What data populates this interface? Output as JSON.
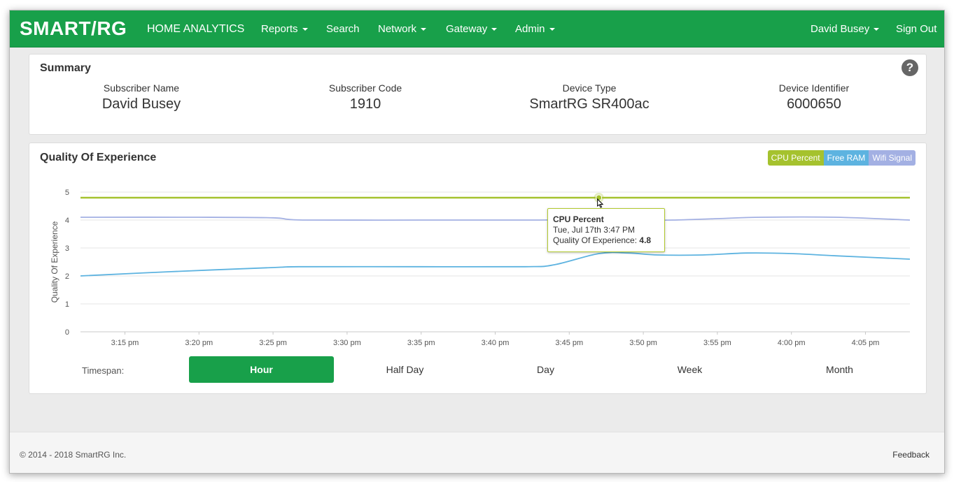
{
  "navbar": {
    "brand": "SMART/RG",
    "title": "HOME ANALYTICS",
    "menu": [
      "Reports",
      "Search",
      "Network",
      "Gateway",
      "Admin"
    ],
    "user": "David Busey",
    "signout": "Sign Out"
  },
  "summary": {
    "title": "Summary",
    "help": "?",
    "fields": [
      {
        "label": "Subscriber Name",
        "value": "David Busey"
      },
      {
        "label": "Subscriber Code",
        "value": "1910"
      },
      {
        "label": "Device Type",
        "value": "SmartRG SR400ac"
      },
      {
        "label": "Device Identifier",
        "value": "6000650"
      }
    ]
  },
  "qoe": {
    "title": "Quality Of Experience",
    "legend": [
      {
        "label": "CPU Percent",
        "color": "#a5c22e"
      },
      {
        "label": "Free RAM",
        "color": "#5db3e0"
      },
      {
        "label": "Wifi Signal",
        "color": "#a3b0e3"
      }
    ],
    "tooltip": {
      "series": "CPU Percent",
      "time": "Tue, Jul 17th 3:47 PM",
      "label": "Quality Of Experience:",
      "value": "4.8"
    },
    "timespan_label": "Timespan:",
    "timespans": [
      "Hour",
      "Half Day",
      "Day",
      "Week",
      "Month"
    ],
    "active_timespan": "Hour"
  },
  "chart_data": {
    "type": "line",
    "ylabel": "Quality Of Experience",
    "ylim": [
      0,
      5
    ],
    "yticks": [
      0,
      1,
      2,
      3,
      4,
      5
    ],
    "xlim_minutes": [
      12,
      68
    ],
    "xticks": [
      "3:15 pm",
      "3:20 pm",
      "3:25 pm",
      "3:30 pm",
      "3:35 pm",
      "3:40 pm",
      "3:45 pm",
      "3:50 pm",
      "3:55 pm",
      "4:00 pm",
      "4:05 pm"
    ],
    "grid": true,
    "legend_position": "top-right",
    "series": [
      {
        "name": "CPU Percent",
        "color": "#a5c22e",
        "x": [
          "3:12 pm",
          "4:08 pm"
        ],
        "values": [
          4.8,
          4.8
        ]
      },
      {
        "name": "Free RAM",
        "color": "#5db3e0",
        "x": [
          "3:12 pm",
          "3:18 pm",
          "3:25 pm",
          "3:27 pm",
          "3:35 pm",
          "3:42 pm",
          "3:44 pm",
          "3:47 pm",
          "3:49 pm",
          "3:51 pm",
          "3:54 pm",
          "3:57 pm",
          "4:00 pm",
          "4:03 pm",
          "4:08 pm"
        ],
        "values": [
          2.0,
          2.15,
          2.3,
          2.33,
          2.33,
          2.33,
          2.4,
          2.8,
          2.82,
          2.75,
          2.75,
          2.82,
          2.8,
          2.72,
          2.6
        ]
      },
      {
        "name": "Wifi Signal",
        "color": "#a3b0e3",
        "x": [
          "3:12 pm",
          "3:20 pm",
          "3:25 pm",
          "3:27 pm",
          "3:35 pm",
          "3:43 pm",
          "3:47 pm",
          "3:50 pm",
          "3:52 pm",
          "3:55 pm",
          "3:58 pm",
          "4:03 pm",
          "4:08 pm"
        ],
        "values": [
          4.1,
          4.1,
          4.08,
          4.0,
          4.0,
          4.0,
          4.02,
          4.0,
          4.0,
          4.05,
          4.1,
          4.1,
          4.0
        ]
      }
    ],
    "highlight": {
      "series": "CPU Percent",
      "x": "3:47 pm",
      "value": 4.8
    }
  },
  "footer": {
    "copyright": "© 2014 - 2018 SmartRG Inc.",
    "feedback": "Feedback"
  }
}
